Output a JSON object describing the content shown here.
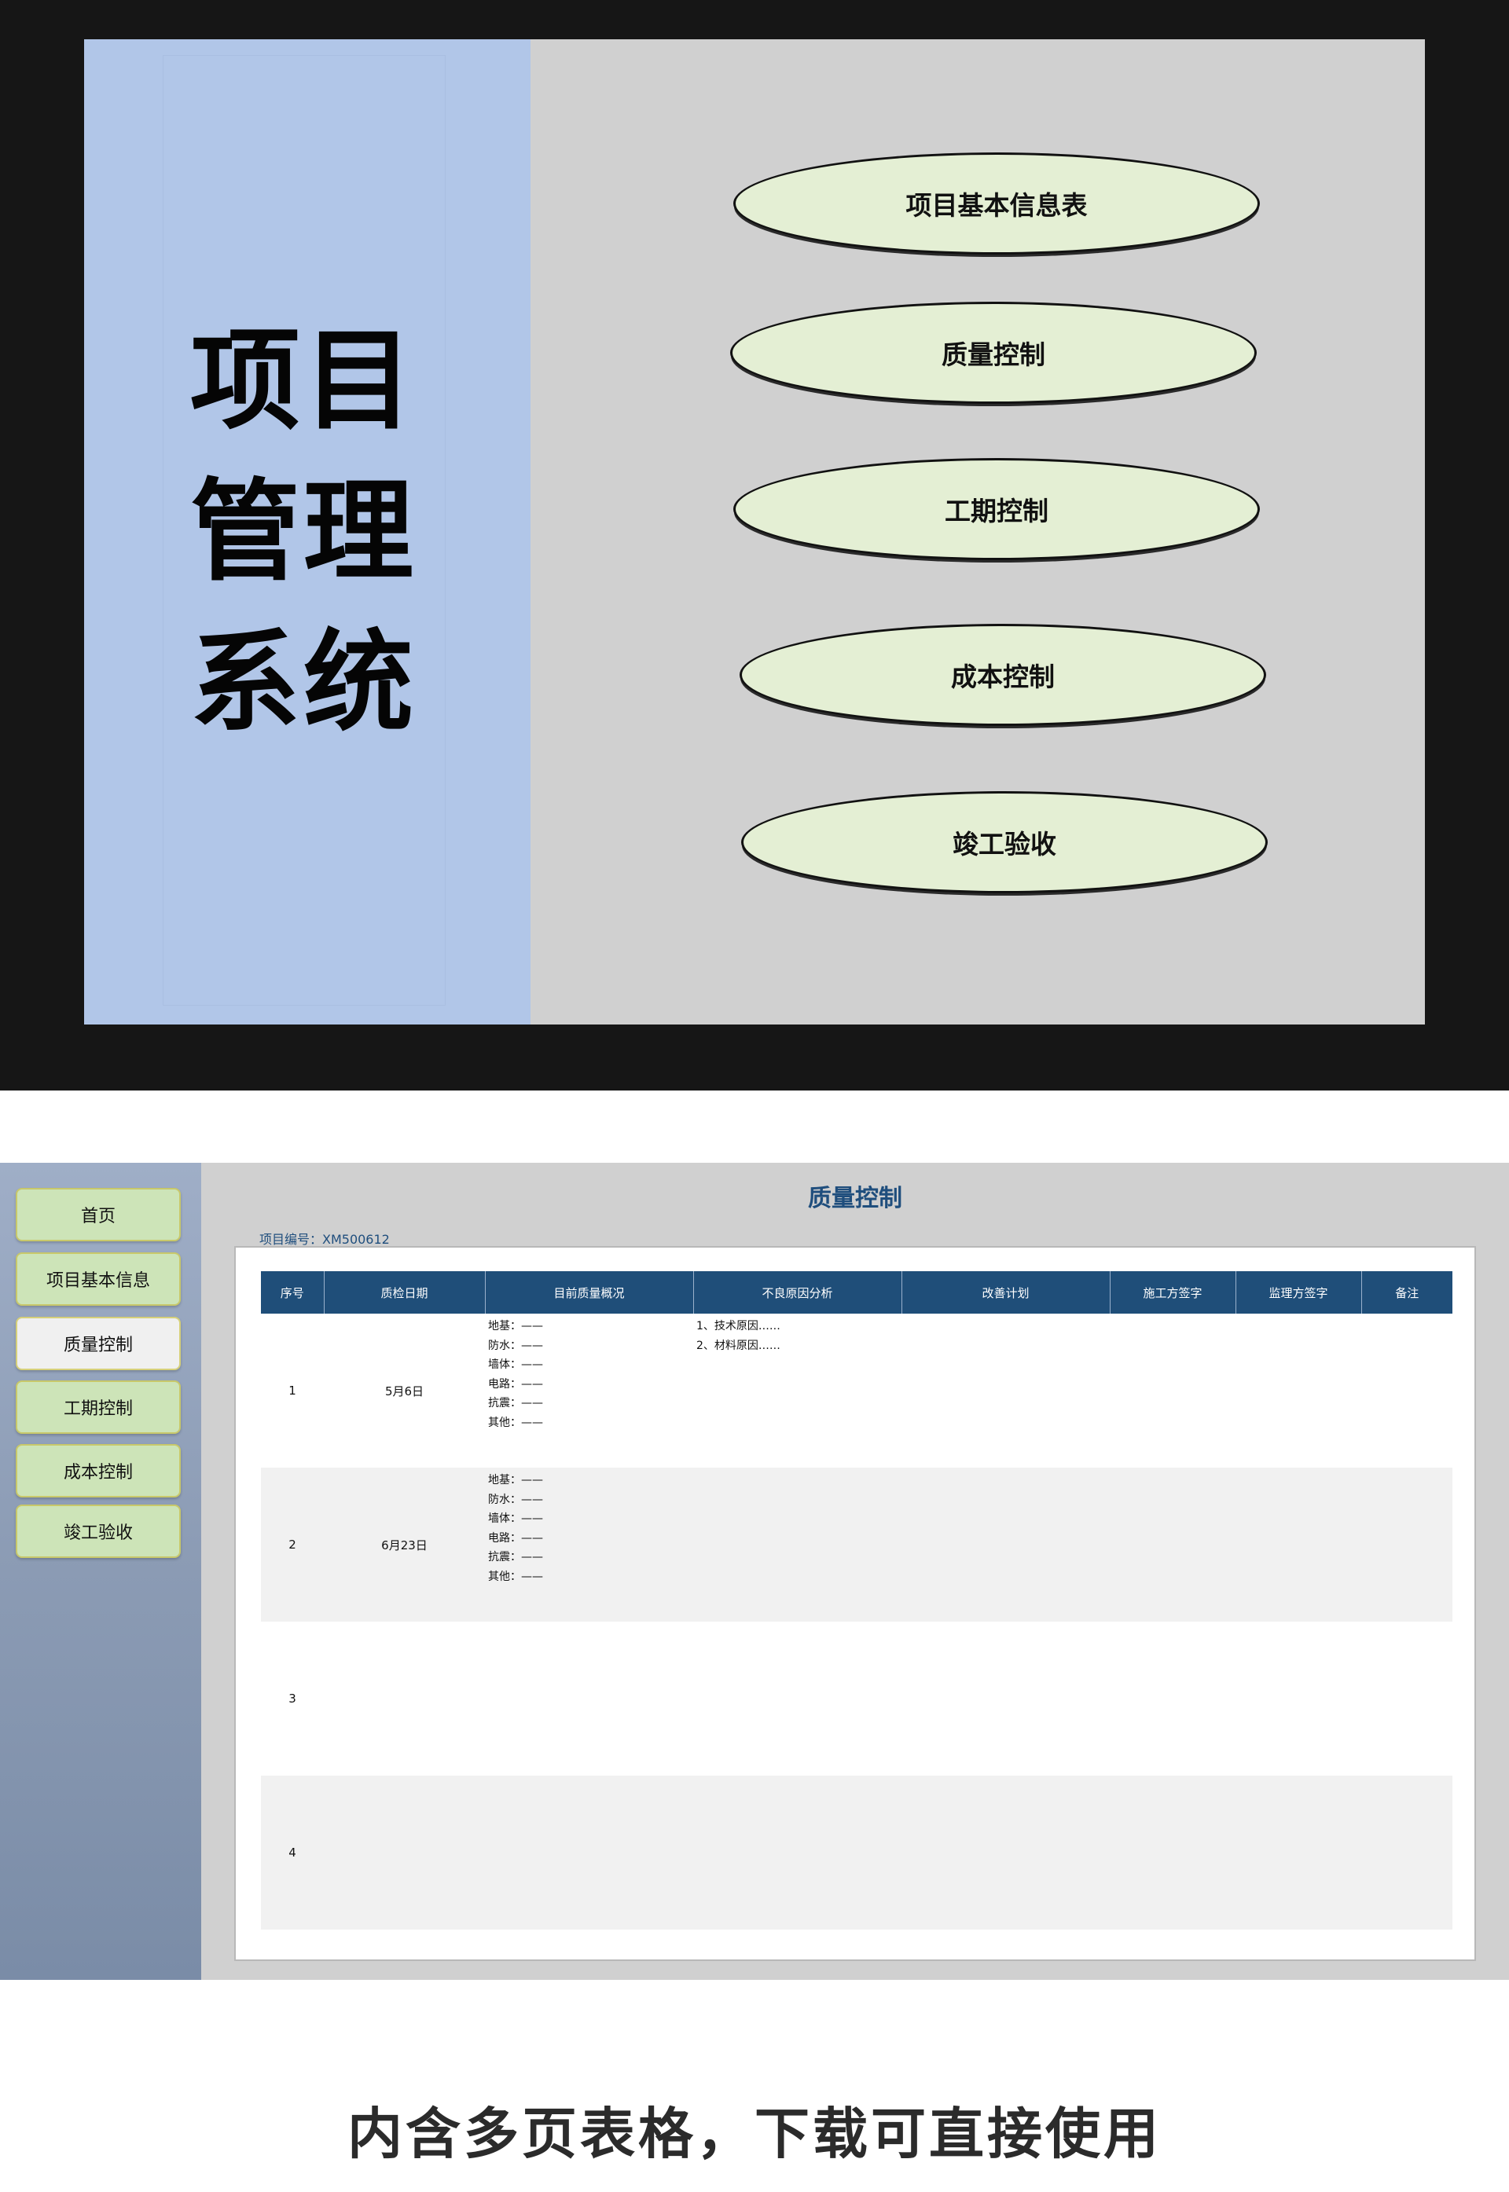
{
  "slide": {
    "title_lines": [
      "项目",
      "管理",
      "系统"
    ],
    "menu_ovals": [
      {
        "label": "项目基本信息表"
      },
      {
        "label": "质量控制"
      },
      {
        "label": "工期控制"
      },
      {
        "label": "成本控制"
      },
      {
        "label": "竣工验收"
      }
    ]
  },
  "app": {
    "sidebar": {
      "items": [
        {
          "label": "首页"
        },
        {
          "label": "项目基本信息"
        },
        {
          "label": "质量控制",
          "active": true
        },
        {
          "label": "工期控制"
        },
        {
          "label": "成本控制"
        },
        {
          "label": "竣工验收"
        }
      ]
    },
    "page_title": "质量控制",
    "project_no": "项目编号：XM500612",
    "table": {
      "headers": [
        "序号",
        "质检日期",
        "目前质量概况",
        "不良原因分析",
        "改善计划",
        "施工方签字",
        "监理方签字",
        "备注"
      ],
      "rows": [
        {
          "no": "1",
          "date": "5月6日",
          "status": [
            "地基：——",
            "防水：——",
            "墙体：——",
            "电路：——",
            "抗震：——",
            "其他：——"
          ],
          "reasons": [
            "1、技术原因……",
            "2、材料原因……"
          ]
        },
        {
          "no": "2",
          "date": "6月23日",
          "status": [
            "地基：——",
            "防水：——",
            "墙体：——",
            "电路：——",
            "抗震：——",
            "其他：——"
          ],
          "reasons": []
        },
        {
          "no": "3",
          "date": "",
          "status": [],
          "reasons": []
        },
        {
          "no": "4",
          "date": "",
          "status": [],
          "reasons": []
        }
      ]
    }
  },
  "footer": "内含多页表格，下载可直接使用",
  "colors": {
    "slide_left": "#b1c6e8",
    "slide_bg": "#d0d0d0",
    "oval_fill": "#e4efd4",
    "table_header": "#1f4e79",
    "title_blue": "#1f4e7d",
    "nav_button": "#cde4b8"
  }
}
